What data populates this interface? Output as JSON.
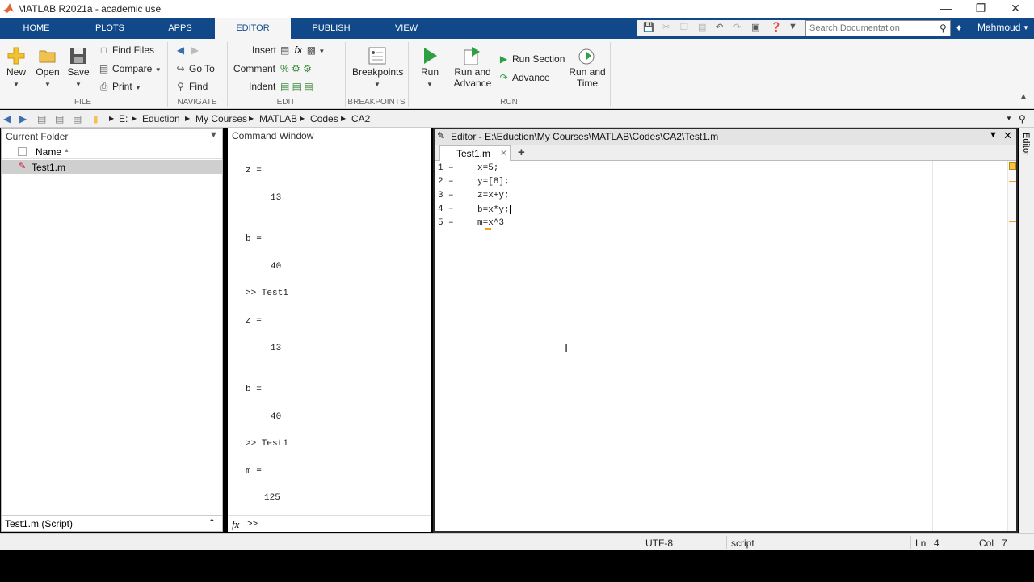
{
  "titlebar": {
    "title": "MATLAB R2021a - academic use"
  },
  "tabs": [
    "HOME",
    "PLOTS",
    "APPS",
    "EDITOR",
    "PUBLISH",
    "VIEW"
  ],
  "search": {
    "placeholder": "Search Documentation"
  },
  "user": {
    "name": "Mahmoud"
  },
  "ribbon": {
    "file": {
      "new": "New",
      "open": "Open",
      "save": "Save",
      "find_files": "Find Files",
      "compare": "Compare",
      "print": "Print",
      "label": "FILE"
    },
    "navigate": {
      "go_to": "Go To",
      "find": "Find",
      "label": "NAVIGATE"
    },
    "edit": {
      "insert": "Insert",
      "comment": "Comment",
      "indent": "Indent",
      "label": "EDIT"
    },
    "breakpoints": {
      "breakpoints": "Breakpoints",
      "label": "BREAKPOINTS"
    },
    "run": {
      "run": "Run",
      "run_and_advance_1": "Run and",
      "run_and_advance_2": "Advance",
      "run_section": "Run Section",
      "advance": "Advance",
      "run_and_time_1": "Run and",
      "run_and_time_2": "Time",
      "label": "RUN"
    }
  },
  "address": {
    "parts": [
      "E:",
      "Eduction",
      "My Courses",
      "MATLAB",
      "Codes",
      "CA2"
    ]
  },
  "current_folder": {
    "title": "Current Folder",
    "column": "Name",
    "file": "Test1.m",
    "details": "Test1.m  (Script)"
  },
  "command_window": {
    "title": "Command Window",
    "lines": [
      "z =",
      "13",
      "b =",
      "40",
      ">> Test1",
      "z =",
      "13",
      "b =",
      "40",
      ">> Test1",
      "m =",
      "125"
    ],
    "prompt": ">>",
    "fx": "fx"
  },
  "editor": {
    "title": "Editor - E:\\Eduction\\My Courses\\MATLAB\\Codes\\CA2\\Test1.m",
    "tab": "Test1.m",
    "code": [
      "x=5;",
      "y=[8];",
      "z=x+y;",
      "b=x*y;",
      "m=x^3"
    ],
    "line_numbers": [
      "1",
      "2",
      "3",
      "4",
      "5"
    ],
    "side_label": "Editor"
  },
  "status": {
    "encoding": "UTF-8",
    "type": "script",
    "ln_label": "Ln",
    "ln": "4",
    "col_label": "Col",
    "col": "7"
  }
}
